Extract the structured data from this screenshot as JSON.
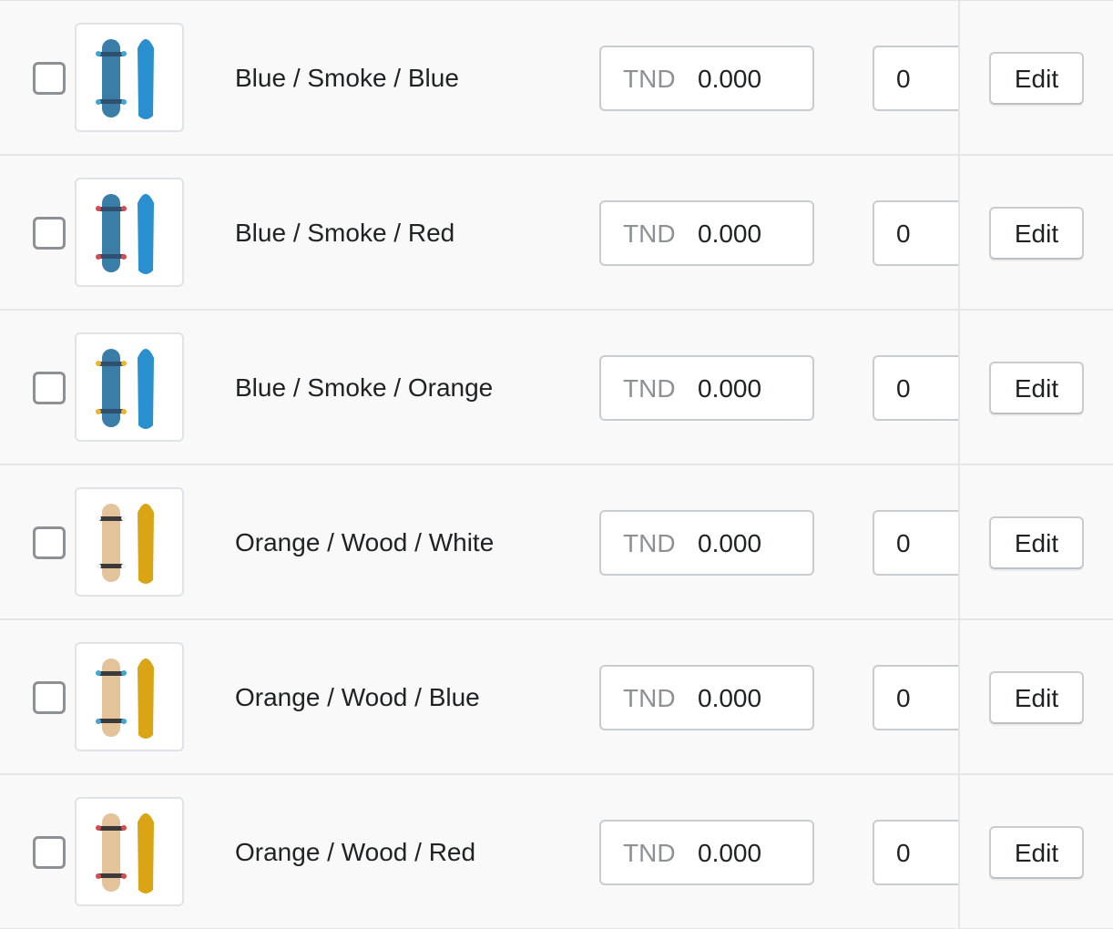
{
  "variants": [
    {
      "title": "Blue / Smoke / Blue",
      "price_prefix": "TND",
      "price": "0.000",
      "quantity": "0",
      "edit_label": "Edit",
      "colors": {
        "deck": "#3a7ea8",
        "truck": "#2f4f6e",
        "wheel": "#3fa7d6",
        "board": "#2a8fcf"
      }
    },
    {
      "title": "Blue / Smoke / Red",
      "price_prefix": "TND",
      "price": "0.000",
      "quantity": "0",
      "edit_label": "Edit",
      "colors": {
        "deck": "#3a7ea8",
        "truck": "#2f4f6e",
        "wheel": "#d94a4a",
        "board": "#2a8fcf"
      }
    },
    {
      "title": "Blue / Smoke / Orange",
      "price_prefix": "TND",
      "price": "0.000",
      "quantity": "0",
      "edit_label": "Edit",
      "colors": {
        "deck": "#3a7ea8",
        "truck": "#2f4f6e",
        "wheel": "#f0b429",
        "board": "#2a8fcf"
      }
    },
    {
      "title": "Orange / Wood / White",
      "price_prefix": "TND",
      "price": "0.000",
      "quantity": "0",
      "edit_label": "Edit",
      "colors": {
        "deck": "#e4c29a",
        "truck": "#3a3a3a",
        "wheel": "#f4f4f4",
        "board": "#d9a514"
      }
    },
    {
      "title": "Orange / Wood / Blue",
      "price_prefix": "TND",
      "price": "0.000",
      "quantity": "0",
      "edit_label": "Edit",
      "colors": {
        "deck": "#e4c29a",
        "truck": "#3a3a3a",
        "wheel": "#3fa7d6",
        "board": "#d9a514"
      }
    },
    {
      "title": "Orange / Wood / Red",
      "price_prefix": "TND",
      "price": "0.000",
      "quantity": "0",
      "edit_label": "Edit",
      "colors": {
        "deck": "#e4c29a",
        "truck": "#3a3a3a",
        "wheel": "#d94a4a",
        "board": "#d9a514"
      }
    }
  ]
}
